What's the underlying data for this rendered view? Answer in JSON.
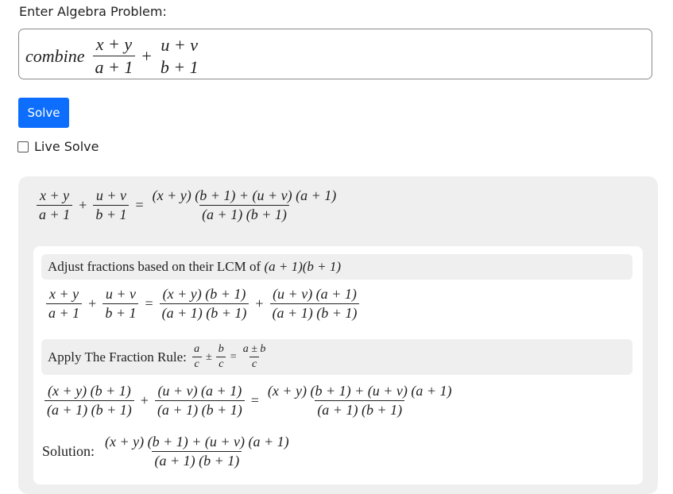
{
  "prompt": {
    "label": "Enter Algebra Problem:"
  },
  "input": {
    "command": "combine",
    "frac1": {
      "num": "x + y",
      "den": "a + 1"
    },
    "op": "+",
    "frac2": {
      "num": "u + v",
      "den": "b + 1"
    }
  },
  "solve_button": {
    "label": "Solve",
    "color": "#0d6efd"
  },
  "live_solve": {
    "label": "Live Solve",
    "checked": false
  },
  "result": {
    "summary": {
      "lhs1": {
        "num": "x + y",
        "den": "a + 1"
      },
      "op": "+",
      "lhs2": {
        "num": "u + v",
        "den": "b + 1"
      },
      "eq": "=",
      "rhs": {
        "num": "(x + y) (b + 1) + (u + v) (a + 1)",
        "den": "(a + 1) (b + 1)"
      }
    },
    "step1": {
      "title_text": "Adjust fractions based on their LCM of ",
      "title_math": "(a + 1)(b + 1)",
      "lhs1": {
        "num": "x + y",
        "den": "a + 1"
      },
      "op": "+",
      "lhs2": {
        "num": "u + v",
        "den": "b + 1"
      },
      "eq": "=",
      "rhs1": {
        "num": "(x + y) (b + 1)",
        "den": "(a + 1) (b + 1)"
      },
      "op2": "+",
      "rhs2": {
        "num": "(u + v) (a + 1)",
        "den": "(a + 1) (b + 1)"
      }
    },
    "step2": {
      "title_text": "Apply The Fraction Rule: ",
      "rule_f1": {
        "num": "a",
        "den": "c"
      },
      "rule_op": "±",
      "rule_f2": {
        "num": "b",
        "den": "c"
      },
      "rule_eq": "=",
      "rule_f3": {
        "num": "a ± b",
        "den": "c"
      },
      "lhs1": {
        "num": "(x + y) (b + 1)",
        "den": "(a + 1) (b + 1)"
      },
      "op": "+",
      "lhs2": {
        "num": "(u + v) (a + 1)",
        "den": "(a + 1) (b + 1)"
      },
      "eq": "=",
      "rhs": {
        "num": "(x + y) (b + 1) + (u + v) (a + 1)",
        "den": "(a + 1) (b + 1)"
      }
    },
    "solution": {
      "label": "Solution:",
      "value": {
        "num": "(x + y) (b + 1) + (u + v) (a + 1)",
        "den": "(a + 1) (b + 1)"
      }
    }
  }
}
